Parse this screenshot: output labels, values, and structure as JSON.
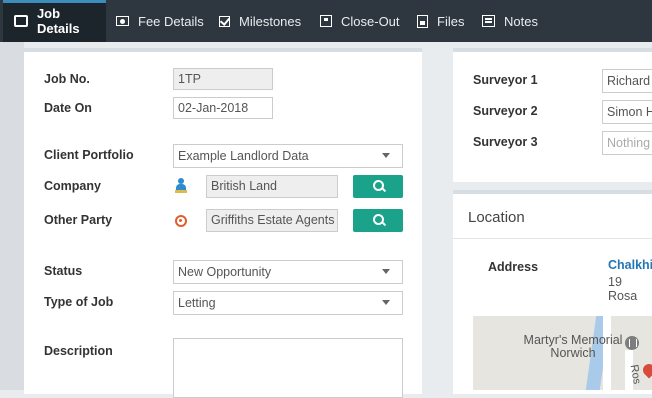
{
  "tabs": [
    {
      "label": "Job Details",
      "icon": "briefcase-icon",
      "active": true
    },
    {
      "label": "Fee Details",
      "icon": "money-icon",
      "active": false
    },
    {
      "label": "Milestones",
      "icon": "checkbox-icon",
      "active": false
    },
    {
      "label": "Close-Out",
      "icon": "archive-box-icon",
      "active": false
    },
    {
      "label": "Files",
      "icon": "file-icon",
      "active": false
    },
    {
      "label": "Notes",
      "icon": "notes-icon",
      "active": false
    }
  ],
  "job": {
    "job_no_label": "Job No.",
    "job_no_value": "1TP",
    "date_on_label": "Date On",
    "date_on_value": "02-Jan-2018",
    "client_portfolio_label": "Client Portfolio",
    "client_portfolio_value": "Example Landlord Data",
    "company_label": "Company",
    "company_value": "British Land",
    "other_party_label": "Other Party",
    "other_party_value": "Griffiths Estate Agents",
    "status_label": "Status",
    "status_value": "New Opportunity",
    "type_of_job_label": "Type of Job",
    "type_of_job_value": "Letting",
    "description_label": "Description",
    "description_value": ""
  },
  "surveyors": {
    "s1_label": "Surveyor 1",
    "s1_value": "Richard",
    "s2_label": "Surveyor 2",
    "s2_value": "Simon H",
    "s3_label": "Surveyor 3",
    "s3_placeholder": "Nothing"
  },
  "location": {
    "title": "Location",
    "address_label": "Address",
    "address_line1": "Chalkhi",
    "address_line2": "19 Rosa",
    "map_label_line1": "Martyr's Memorial",
    "map_label_line2": "Norwich",
    "map_street_fragment": "Ros"
  },
  "colors": {
    "tabbar": "#2e3740",
    "active_tab": "#1d252c",
    "accent": "#3c8dbc",
    "search_button": "#1aa28b",
    "link": "#2377b5"
  }
}
